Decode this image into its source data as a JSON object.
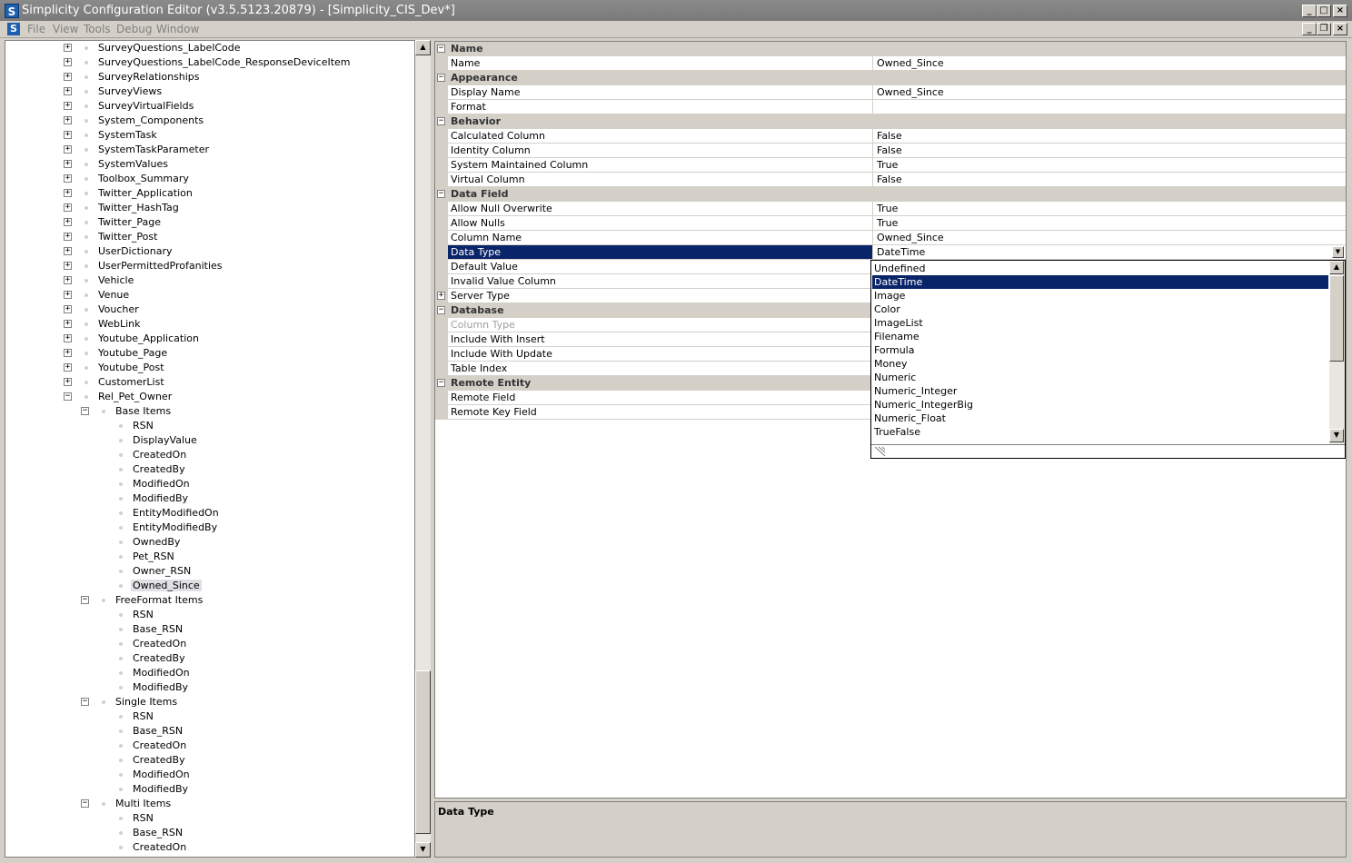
{
  "window": {
    "title": "Simplicity Configuration Editor (v3.5.5123.20879) - [Simplicity_CIS_Dev*]"
  },
  "menu": [
    "File",
    "View",
    "Tools",
    "Debug",
    "Window"
  ],
  "tree": [
    {
      "label": "SurveyQuestions_LabelCode",
      "level": 0,
      "exp": "+"
    },
    {
      "label": "SurveyQuestions_LabelCode_ResponseDeviceItem",
      "level": 0,
      "exp": "+"
    },
    {
      "label": "SurveyRelationships",
      "level": 0,
      "exp": "+"
    },
    {
      "label": "SurveyViews",
      "level": 0,
      "exp": "+"
    },
    {
      "label": "SurveyVirtualFields",
      "level": 0,
      "exp": "+"
    },
    {
      "label": "System_Components",
      "level": 0,
      "exp": "+"
    },
    {
      "label": "SystemTask",
      "level": 0,
      "exp": "+"
    },
    {
      "label": "SystemTaskParameter",
      "level": 0,
      "exp": "+"
    },
    {
      "label": "SystemValues",
      "level": 0,
      "exp": "+"
    },
    {
      "label": "Toolbox_Summary",
      "level": 0,
      "exp": "+"
    },
    {
      "label": "Twitter_Application",
      "level": 0,
      "exp": "+"
    },
    {
      "label": "Twitter_HashTag",
      "level": 0,
      "exp": "+"
    },
    {
      "label": "Twitter_Page",
      "level": 0,
      "exp": "+"
    },
    {
      "label": "Twitter_Post",
      "level": 0,
      "exp": "+"
    },
    {
      "label": "UserDictionary",
      "level": 0,
      "exp": "+"
    },
    {
      "label": "UserPermittedProfanities",
      "level": 0,
      "exp": "+"
    },
    {
      "label": "Vehicle",
      "level": 0,
      "exp": "+"
    },
    {
      "label": "Venue",
      "level": 0,
      "exp": "+"
    },
    {
      "label": "Voucher",
      "level": 0,
      "exp": "+"
    },
    {
      "label": "WebLink",
      "level": 0,
      "exp": "+"
    },
    {
      "label": "Youtube_Application",
      "level": 0,
      "exp": "+"
    },
    {
      "label": "Youtube_Page",
      "level": 0,
      "exp": "+"
    },
    {
      "label": "Youtube_Post",
      "level": 0,
      "exp": "+"
    },
    {
      "label": "CustomerList",
      "level": 0,
      "exp": "+"
    },
    {
      "label": "Rel_Pet_Owner",
      "level": 0,
      "exp": "-"
    },
    {
      "label": "Base Items",
      "level": 1,
      "exp": "-"
    },
    {
      "label": "RSN",
      "level": 2,
      "exp": ""
    },
    {
      "label": "DisplayValue",
      "level": 2,
      "exp": ""
    },
    {
      "label": "CreatedOn",
      "level": 2,
      "exp": ""
    },
    {
      "label": "CreatedBy",
      "level": 2,
      "exp": ""
    },
    {
      "label": "ModifiedOn",
      "level": 2,
      "exp": ""
    },
    {
      "label": "ModifiedBy",
      "level": 2,
      "exp": ""
    },
    {
      "label": "EntityModifiedOn",
      "level": 2,
      "exp": ""
    },
    {
      "label": "EntityModifiedBy",
      "level": 2,
      "exp": ""
    },
    {
      "label": "OwnedBy",
      "level": 2,
      "exp": ""
    },
    {
      "label": "Pet_RSN",
      "level": 2,
      "exp": ""
    },
    {
      "label": "Owner_RSN",
      "level": 2,
      "exp": ""
    },
    {
      "label": "Owned_Since",
      "level": 2,
      "exp": "",
      "selected": true
    },
    {
      "label": "FreeFormat Items",
      "level": 1,
      "exp": "-"
    },
    {
      "label": "RSN",
      "level": 2,
      "exp": ""
    },
    {
      "label": "Base_RSN",
      "level": 2,
      "exp": ""
    },
    {
      "label": "CreatedOn",
      "level": 2,
      "exp": ""
    },
    {
      "label": "CreatedBy",
      "level": 2,
      "exp": ""
    },
    {
      "label": "ModifiedOn",
      "level": 2,
      "exp": ""
    },
    {
      "label": "ModifiedBy",
      "level": 2,
      "exp": ""
    },
    {
      "label": "Single Items",
      "level": 1,
      "exp": "-"
    },
    {
      "label": "RSN",
      "level": 2,
      "exp": ""
    },
    {
      "label": "Base_RSN",
      "level": 2,
      "exp": ""
    },
    {
      "label": "CreatedOn",
      "level": 2,
      "exp": ""
    },
    {
      "label": "CreatedBy",
      "level": 2,
      "exp": ""
    },
    {
      "label": "ModifiedOn",
      "level": 2,
      "exp": ""
    },
    {
      "label": "ModifiedBy",
      "level": 2,
      "exp": ""
    },
    {
      "label": "Multi Items",
      "level": 1,
      "exp": "-"
    },
    {
      "label": "RSN",
      "level": 2,
      "exp": ""
    },
    {
      "label": "Base_RSN",
      "level": 2,
      "exp": ""
    },
    {
      "label": "CreatedOn",
      "level": 2,
      "exp": ""
    }
  ],
  "properties": [
    {
      "type": "cat",
      "label": "Name",
      "exp": "-"
    },
    {
      "type": "prop",
      "name": "Name",
      "value": "Owned_Since"
    },
    {
      "type": "cat",
      "label": "Appearance",
      "exp": "-"
    },
    {
      "type": "prop",
      "name": "Display Name",
      "value": "Owned_Since"
    },
    {
      "type": "prop",
      "name": "Format",
      "value": ""
    },
    {
      "type": "cat",
      "label": "Behavior",
      "exp": "-"
    },
    {
      "type": "prop",
      "name": "Calculated Column",
      "value": "False"
    },
    {
      "type": "prop",
      "name": "Identity Column",
      "value": "False"
    },
    {
      "type": "prop",
      "name": "System Maintained Column",
      "value": "True"
    },
    {
      "type": "prop",
      "name": "Virtual Column",
      "value": "False"
    },
    {
      "type": "cat",
      "label": "Data Field",
      "exp": "-"
    },
    {
      "type": "prop",
      "name": "Allow Null Overwrite",
      "value": "True"
    },
    {
      "type": "prop",
      "name": "Allow Nulls",
      "value": "True"
    },
    {
      "type": "prop",
      "name": "Column Name",
      "value": "Owned_Since"
    },
    {
      "type": "prop",
      "name": "Data Type",
      "value": "DateTime",
      "selected": true,
      "dropdown": true
    },
    {
      "type": "prop",
      "name": "Default Value",
      "value": ""
    },
    {
      "type": "prop",
      "name": "Invalid Value Column",
      "value": ""
    },
    {
      "type": "prop",
      "name": "Server Type",
      "value": "",
      "exp": "+"
    },
    {
      "type": "cat",
      "label": "Database",
      "exp": "-"
    },
    {
      "type": "prop",
      "name": "Column Type",
      "value": "",
      "dim": true
    },
    {
      "type": "prop",
      "name": "Include With Insert",
      "value": ""
    },
    {
      "type": "prop",
      "name": "Include With Update",
      "value": ""
    },
    {
      "type": "prop",
      "name": "Table Index",
      "value": ""
    },
    {
      "type": "cat",
      "label": "Remote Entity",
      "exp": "-"
    },
    {
      "type": "prop",
      "name": "Remote Field",
      "value": ""
    },
    {
      "type": "prop",
      "name": "Remote Key Field",
      "value": ""
    }
  ],
  "dropdown": {
    "selected": "DateTime",
    "options": [
      "Undefined",
      "DateTime",
      "Image",
      "Color",
      "ImageList",
      "Filename",
      "Formula",
      "Money",
      "Numeric",
      "Numeric_Integer",
      "Numeric_IntegerBig",
      "Numeric_Float",
      "TrueFalse"
    ]
  },
  "description": {
    "title": "Data Type"
  },
  "colors": {
    "selection": "#0a246a",
    "chrome": "#d4d0c8",
    "titlebar": "#808080"
  }
}
